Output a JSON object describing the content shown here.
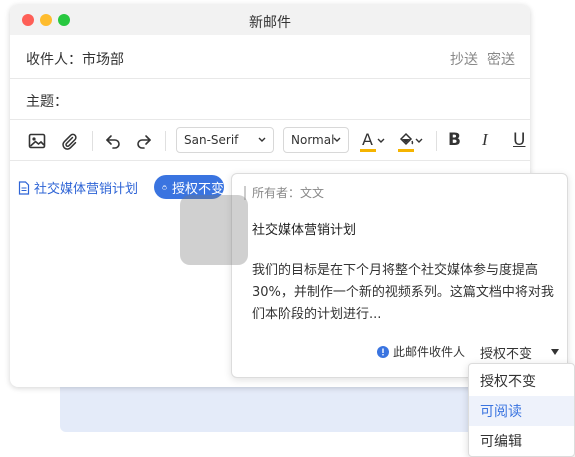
{
  "window": {
    "title": "新邮件"
  },
  "to": {
    "label": "收件人：",
    "value": "市场部",
    "cc": "抄送",
    "bcc": "密送"
  },
  "subject": {
    "label": "主题："
  },
  "toolbar": {
    "font": "San-Serif",
    "size": "Normal",
    "text_color": "A",
    "bold": "B",
    "italic": "I",
    "underline": "U"
  },
  "attachment": {
    "name": "社交媒体营销计划",
    "auth_pill": "授权不变"
  },
  "popup": {
    "owner": "所有者：文文",
    "doc_title": "社交媒体营销计划",
    "doc_body": "我们的目标是在下个月将整个社交媒体参与度提高30%，并制作一个新的视频系列。这篇文档中将对我们本阶段的计划进行...",
    "recipient_note": "此邮件收件人",
    "permission": "授权不变"
  },
  "dropdown": {
    "options": [
      "授权不变",
      "可阅读",
      "可编辑"
    ],
    "selected": "可阅读"
  },
  "colors": {
    "accent": "#3a74e0",
    "link": "#2e64d6",
    "text_color_bar": "#f5b400",
    "highlight_bar": "#f5b400"
  }
}
